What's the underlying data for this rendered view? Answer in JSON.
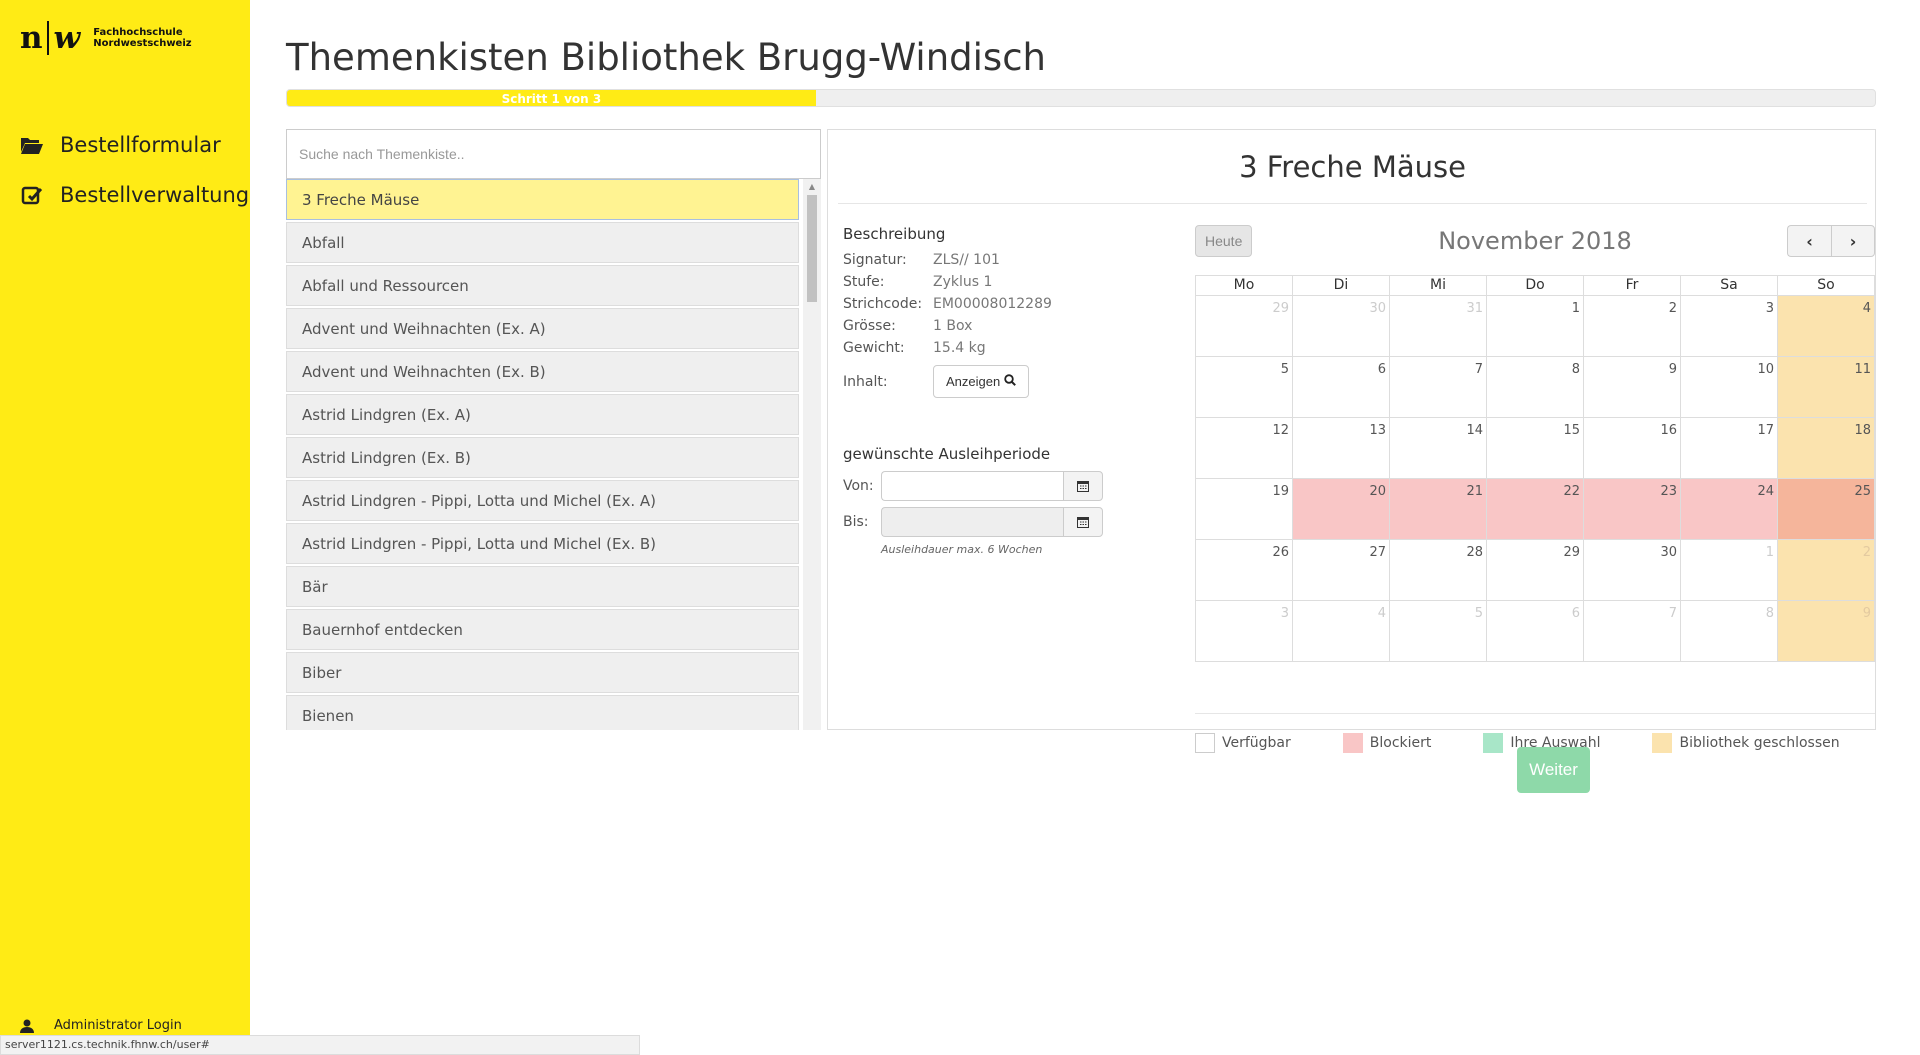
{
  "brand": {
    "logo_n": "n",
    "logo_w": "w",
    "line1": "Fachhochschule",
    "line2": "Nordwestschweiz"
  },
  "sidebar": {
    "items": [
      {
        "label": "Bestellformular",
        "icon": "folder-open-icon"
      },
      {
        "label": "Bestellverwaltung",
        "icon": "edit-icon"
      }
    ],
    "admin_label": "Administrator Login"
  },
  "status_url": "server1121.cs.technik.fhnw.ch/user#",
  "page_title": "Themenkisten Bibliothek Brugg-Windisch",
  "progress": {
    "label": "Schritt 1 von 3",
    "fraction": 0.333,
    "color": "#ffeb15"
  },
  "search": {
    "placeholder": "Suche nach Themenkiste..",
    "value": ""
  },
  "list": {
    "items": [
      "3 Freche Mäuse",
      "Abfall",
      "Abfall und Ressourcen",
      "Advent und Weihnachten (Ex. A)",
      "Advent und Weihnachten (Ex. B)",
      "Astrid Lindgren (Ex. A)",
      "Astrid Lindgren (Ex. B)",
      "Astrid Lindgren - Pippi, Lotta und Michel (Ex. A)",
      "Astrid Lindgren - Pippi, Lotta und Michel (Ex. B)",
      "Bär",
      "Bauernhof entdecken",
      "Biber",
      "Bienen"
    ],
    "selected": 0
  },
  "detail": {
    "title": "3 Freche Mäuse",
    "description_heading": "Beschreibung",
    "fields": [
      {
        "key": "Signatur:",
        "value": "ZLS// 101"
      },
      {
        "key": "Stufe:",
        "value": "Zyklus 1"
      },
      {
        "key": "Strichcode:",
        "value": "EM00008012289"
      },
      {
        "key": "Grösse:",
        "value": "1 Box"
      },
      {
        "key": "Gewicht:",
        "value": "15.4 kg"
      }
    ],
    "inhalt_label": "Inhalt:",
    "show_button": "Anzeigen",
    "period_heading": "gewünschte Ausleihperiode",
    "from_label": "Von:",
    "to_label": "Bis:",
    "from_value": "",
    "to_value": "",
    "hint": "Ausleihdauer max. 6 Wochen"
  },
  "calendar": {
    "today_label": "Heute",
    "month_title": "November 2018",
    "prev_icon": "chevron-left-icon",
    "next_icon": "chevron-right-icon",
    "weekdays": [
      "Mo",
      "Di",
      "Mi",
      "Do",
      "Fr",
      "Sa",
      "So"
    ],
    "weeks": [
      [
        {
          "d": "29",
          "s": "other"
        },
        {
          "d": "30",
          "s": "other"
        },
        {
          "d": "31",
          "s": "other"
        },
        {
          "d": "1",
          "s": ""
        },
        {
          "d": "2",
          "s": ""
        },
        {
          "d": "3",
          "s": ""
        },
        {
          "d": "4",
          "s": "closed"
        }
      ],
      [
        {
          "d": "5",
          "s": ""
        },
        {
          "d": "6",
          "s": ""
        },
        {
          "d": "7",
          "s": ""
        },
        {
          "d": "8",
          "s": ""
        },
        {
          "d": "9",
          "s": ""
        },
        {
          "d": "10",
          "s": ""
        },
        {
          "d": "11",
          "s": "closed"
        }
      ],
      [
        {
          "d": "12",
          "s": ""
        },
        {
          "d": "13",
          "s": ""
        },
        {
          "d": "14",
          "s": ""
        },
        {
          "d": "15",
          "s": ""
        },
        {
          "d": "16",
          "s": ""
        },
        {
          "d": "17",
          "s": ""
        },
        {
          "d": "18",
          "s": "closed"
        }
      ],
      [
        {
          "d": "19",
          "s": ""
        },
        {
          "d": "20",
          "s": "blocked"
        },
        {
          "d": "21",
          "s": "blocked"
        },
        {
          "d": "22",
          "s": "blocked"
        },
        {
          "d": "23",
          "s": "blocked"
        },
        {
          "d": "24",
          "s": "blocked"
        },
        {
          "d": "25",
          "s": "blocked-closed"
        }
      ],
      [
        {
          "d": "26",
          "s": ""
        },
        {
          "d": "27",
          "s": ""
        },
        {
          "d": "28",
          "s": ""
        },
        {
          "d": "29",
          "s": ""
        },
        {
          "d": "30",
          "s": ""
        },
        {
          "d": "1",
          "s": "other"
        },
        {
          "d": "2",
          "s": "closed other"
        }
      ],
      [
        {
          "d": "3",
          "s": "other"
        },
        {
          "d": "4",
          "s": "other"
        },
        {
          "d": "5",
          "s": "other"
        },
        {
          "d": "6",
          "s": "other"
        },
        {
          "d": "7",
          "s": "other"
        },
        {
          "d": "8",
          "s": "other"
        },
        {
          "d": "9",
          "s": "closed other"
        }
      ]
    ],
    "legend": [
      {
        "label": "Verfügbar",
        "color": "#ffffff"
      },
      {
        "label": "Blockiert",
        "color": "#f9c6c6"
      },
      {
        "label": "Ihre Auswahl",
        "color": "#a8e6c8"
      },
      {
        "label": "Bibliothek geschlossen",
        "color": "#fbe3ae"
      }
    ]
  },
  "next_button": "Weiter",
  "colors": {
    "sidebar": "#ffeb15",
    "accent_green": "#8ed9a9"
  }
}
